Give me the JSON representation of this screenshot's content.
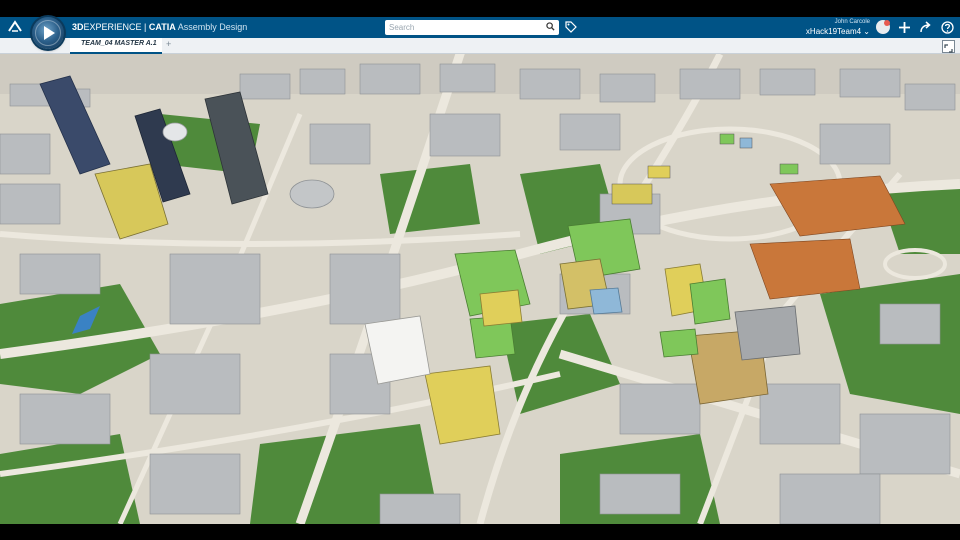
{
  "header": {
    "brand_prefix": "3D",
    "brand_name": "EXPERIENCE",
    "brand_sep": " | ",
    "brand_product": "CATIA",
    "app_name": " Assembly Design",
    "search_placeholder": "Search",
    "user_name": "John Carcole",
    "team": "xHack19Team4",
    "team_chevron": "⌄",
    "icons": [
      "3ds-logo-icon",
      "compass-icon",
      "search-icon",
      "tag-icon",
      "avatar",
      "add-icon",
      "share-icon",
      "help-icon"
    ]
  },
  "tabs": [
    {
      "label": "TEAM_04 MASTER A.1",
      "active": true
    }
  ],
  "tab_add_label": "+",
  "viewport": {
    "content": "3D city model",
    "colors": {
      "ground": "#d9d5c9",
      "road": "#ece8de",
      "park": "#4f8a3b",
      "building": "#b9bcbf",
      "tower_dark": "#3a4a6a",
      "highlight_yellow": "#e0cf5a",
      "highlight_green": "#7fc75a",
      "highlight_orange": "#c9773a",
      "accent": "#005386"
    }
  }
}
